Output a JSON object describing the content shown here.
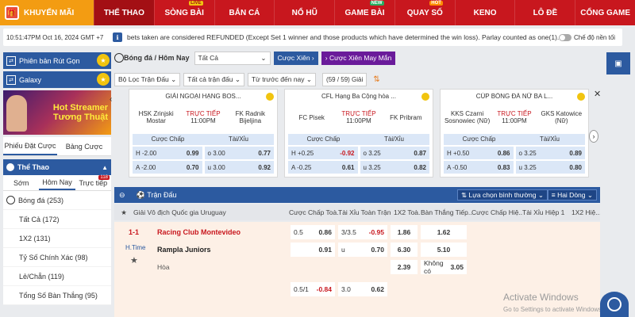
{
  "topnav": {
    "promo": "KHUYẾN MÃI",
    "items": [
      {
        "label": "THỂ THAO",
        "badge": ""
      },
      {
        "label": "SÒNG BÀI",
        "badge": "LIVE"
      },
      {
        "label": "BẮN CÁ",
        "badge": ""
      },
      {
        "label": "NỔ HŨ",
        "badge": ""
      },
      {
        "label": "GAME BÀI",
        "badge": "NEW"
      },
      {
        "label": "QUAY SỐ",
        "badge": "HOT"
      },
      {
        "label": "KENO",
        "badge": ""
      },
      {
        "label": "LÔ ĐỀ",
        "badge": ""
      },
      {
        "label": "CỔNG GAME",
        "badge": ""
      }
    ]
  },
  "ticker": {
    "time": "10:51:47PM Oct 16, 2024 GMT +7",
    "message": "bets taken are considered REFUNDED (Except Set 1 winner and those products which have determined the win loss). Parlay counted as one(1). Thank",
    "toggle_label": "Chế độ nền tối"
  },
  "sidebar": {
    "btn_short": "Phiên bản Rút Gọn",
    "btn_galaxy": "Galaxy",
    "banner_line1": "Hot Streamer",
    "banner_line2": "Tương Thuật",
    "tab_slip": "Phiếu Đặt Cược",
    "tab_history": "Bảng Cược",
    "sport_head": "Thể Thao",
    "time_tabs": [
      "Sớm",
      "Hôm Nay",
      "Trực tiếp"
    ],
    "live_count": "118",
    "sports": [
      "Bóng đá (253)",
      "Tất Cả (172)",
      "1X2 (131)",
      "Tỷ Số Chính Xác (98)",
      "Lẻ/Chẵn (119)",
      "Tổng Số Bàn Thắng (95)"
    ]
  },
  "filters": {
    "title": "Bóng đá / Hôm Nay",
    "all_select": "Tất Cả",
    "btn_parlay": "Cược Xiên",
    "btn_lucky": "Cược Xiên May Mắn",
    "league_filter": "Bộ Lọc Trận Đấu",
    "all_matches": "Tất cả trận đấu",
    "time_filter": "Từ trước đến nay",
    "count": "(59 / 59) Giải"
  },
  "cards": [
    {
      "league": "GIẢI NGOẠI HẠNG BOS...",
      "home": "HSK Zrinjski Mostar",
      "away": "FK Radnik Bijeljina",
      "live": "TRỰC TIẾP",
      "kickoff": "11:00PM",
      "hdr_handicap": "Cược Chấp",
      "hdr_ou": "Tài/Xỉu",
      "row1": {
        "hl": "H",
        "hline": "-2.00",
        "hodd": "0.99",
        "ol": "o",
        "oline": "3.00",
        "oodd": "0.77",
        "red": false
      },
      "row2": {
        "hl": "A",
        "hline": "-2.00",
        "hodd": "0.70",
        "ol": "u",
        "oline": "3.00",
        "oodd": "0.92"
      }
    },
    {
      "league": "CFL Hạng Ba Cộng hòa ...",
      "home": "FC Pisek",
      "away": "FK Pribram",
      "live": "TRỰC TIẾP",
      "kickoff": "11:00PM",
      "hdr_handicap": "Cược Chấp",
      "hdr_ou": "Tài/Xỉu",
      "row1": {
        "hl": "H",
        "hline": "+0.25",
        "hodd": "-0.92",
        "ol": "o",
        "oline": "3.25",
        "oodd": "0.87",
        "red": true
      },
      "row2": {
        "hl": "A",
        "hline": "-0.25",
        "hodd": "0.61",
        "ol": "u",
        "oline": "3.25",
        "oodd": "0.82"
      }
    },
    {
      "league": "CÚP BÓNG ĐÁ NỮ BA L...",
      "home": "KKS Czarni Sosnowiec (Nữ)",
      "away": "GKS Katowice (Nữ)",
      "live": "TRỰC TIẾP",
      "kickoff": "11:00PM",
      "hdr_handicap": "Cược Chấp",
      "hdr_ou": "Tài/Xỉu",
      "row1": {
        "hl": "H",
        "hline": "+0.50",
        "hodd": "0.86",
        "ol": "o",
        "oline": "3.25",
        "oodd": "0.89",
        "red": false
      },
      "row2": {
        "hl": "A",
        "hline": "-0.50",
        "hodd": "0.83",
        "ol": "u",
        "oline": "3.25",
        "oodd": "0.80"
      }
    }
  ],
  "match_section": {
    "title": "Trận Đấu",
    "sort_select": "Lựa chọn bình thường",
    "lines_select": "Hai Dòng",
    "league": "Giải Vô địch Quốc gia Uruguay",
    "columns": [
      "Cược Chấp Toà...",
      "Tài Xỉu Toàn Trận",
      "1X2 Toà...",
      "Bàn Thắng Tiếp...",
      "Cược Chấp Hiệ...",
      "Tài Xỉu Hiệp 1",
      "1X2 Hiệ..."
    ],
    "score": "1-1",
    "period": "H.Time",
    "home": "Racing Club Montevideo",
    "away": "Rampla Juniors",
    "draw": "Hòa",
    "odds": {
      "hc_line1": "0.5",
      "hc_odd1": "0.86",
      "hc_odd2": "0.91",
      "ou_line1": "3/3.5",
      "ou_odd1": "-0.95",
      "ou_line2": "u",
      "ou_odd2": "0.70",
      "x12_1": "1.86",
      "x12_2": "6.30",
      "x12_3": "2.39",
      "ng_1": "1.62",
      "ng_2": "5.10",
      "ng_none_label": "Không có",
      "ng_none": "3.05",
      "r2_hc_line": "0.5/1",
      "r2_hc_odd": "-0.84",
      "r2_ou_line": "3.0",
      "r2_ou_odd": "0.62"
    }
  },
  "watermark": {
    "line1": "Activate Windows",
    "line2": "Go to Settings to activate Windows."
  }
}
